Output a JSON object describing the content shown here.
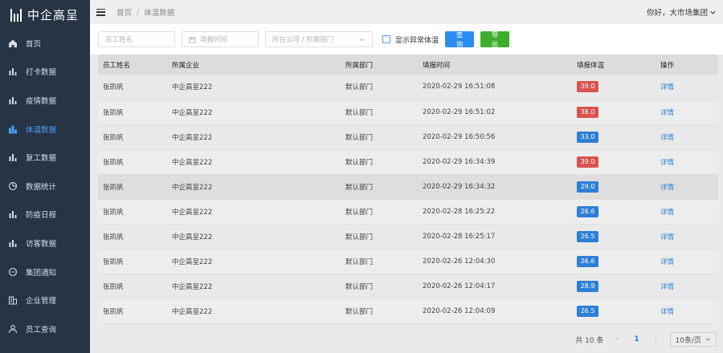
{
  "brand": {
    "name": "中企高呈"
  },
  "sidebar": {
    "items": [
      {
        "label": "首页",
        "icon": "home-icon",
        "active": false
      },
      {
        "label": "打卡数据",
        "icon": "bar-chart-icon",
        "active": false
      },
      {
        "label": "疫情数据",
        "icon": "bar-chart-icon",
        "active": false
      },
      {
        "label": "体温数据",
        "icon": "bar-chart-icon",
        "active": true
      },
      {
        "label": "复工数据",
        "icon": "bar-chart-icon",
        "active": false
      },
      {
        "label": "数据统计",
        "icon": "pie-chart-icon",
        "active": false
      },
      {
        "label": "防疫日报",
        "icon": "bar-chart-icon",
        "active": false
      },
      {
        "label": "访客数据",
        "icon": "bar-chart-icon",
        "active": false
      },
      {
        "label": "集团通知",
        "icon": "chat-icon",
        "active": false
      },
      {
        "label": "企业管理",
        "icon": "building-icon",
        "active": false
      },
      {
        "label": "员工查询",
        "icon": "user-icon",
        "active": false
      }
    ]
  },
  "header": {
    "breadcrumb": [
      "首页",
      "体温数据"
    ],
    "breadcrumb_sep": "/",
    "user_greeting": "你好，大市场集团"
  },
  "filter": {
    "name_placeholder": "员工姓名",
    "date_placeholder": "填报时间",
    "dept_placeholder": "所在公司 / 所属部门",
    "abnormal_label": "显示异常体温",
    "query_label": "查询",
    "export_label": "导出"
  },
  "table": {
    "columns": [
      "员工姓名",
      "所属企业",
      "所属部门",
      "填报时间",
      "填报体温",
      "操作"
    ],
    "rows": [
      {
        "name": "张凯帆",
        "company": "中企高呈222",
        "dept": "默认部门",
        "time": "2020-02-29 16:51:08",
        "temp": "39.0",
        "status": "red",
        "action": "详情"
      },
      {
        "name": "张凯帆",
        "company": "中企高呈222",
        "dept": "默认部门",
        "time": "2020-02-29 16:51:02",
        "temp": "38.0",
        "status": "red",
        "action": "详情"
      },
      {
        "name": "张凯帆",
        "company": "中企高呈222",
        "dept": "默认部门",
        "time": "2020-02-29 16:50:56",
        "temp": "33.0",
        "status": "blue",
        "action": "详情"
      },
      {
        "name": "张凯帆",
        "company": "中企高呈222",
        "dept": "默认部门",
        "time": "2020-02-29 16:34:39",
        "temp": "39.0",
        "status": "red",
        "action": "详情"
      },
      {
        "name": "张凯帆",
        "company": "中企高呈222",
        "dept": "默认部门",
        "time": "2020-02-29 16:34:32",
        "temp": "29.0",
        "status": "blue",
        "action": "详情"
      },
      {
        "name": "张凯帆",
        "company": "中企高呈222",
        "dept": "默认部门",
        "time": "2020-02-28 16:25:22",
        "temp": "26.6",
        "status": "blue",
        "action": "详情"
      },
      {
        "name": "张凯帆",
        "company": "中企高呈222",
        "dept": "默认部门",
        "time": "2020-02-28 16:25:17",
        "temp": "26.5",
        "status": "blue",
        "action": "详情"
      },
      {
        "name": "张凯帆",
        "company": "中企高呈222",
        "dept": "默认部门",
        "time": "2020-02-26 12:04:30",
        "temp": "26.6",
        "status": "blue",
        "action": "详情"
      },
      {
        "name": "张凯帆",
        "company": "中企高呈222",
        "dept": "默认部门",
        "time": "2020-02-26 12:04:17",
        "temp": "28.9",
        "status": "blue",
        "action": "详情"
      },
      {
        "name": "张凯帆",
        "company": "中企高呈222",
        "dept": "默认部门",
        "time": "2020-02-26 12:04:09",
        "temp": "26.5",
        "status": "blue",
        "action": "详情"
      }
    ]
  },
  "pagination": {
    "total_label": "共 10 条",
    "prev": "‹",
    "current": "1",
    "next": "›",
    "page_size": "10条/页"
  },
  "colors": {
    "sidebar_bg": "#263446",
    "accent": "#2d8cf0",
    "danger": "#d9534f",
    "success": "#3fae2e"
  }
}
